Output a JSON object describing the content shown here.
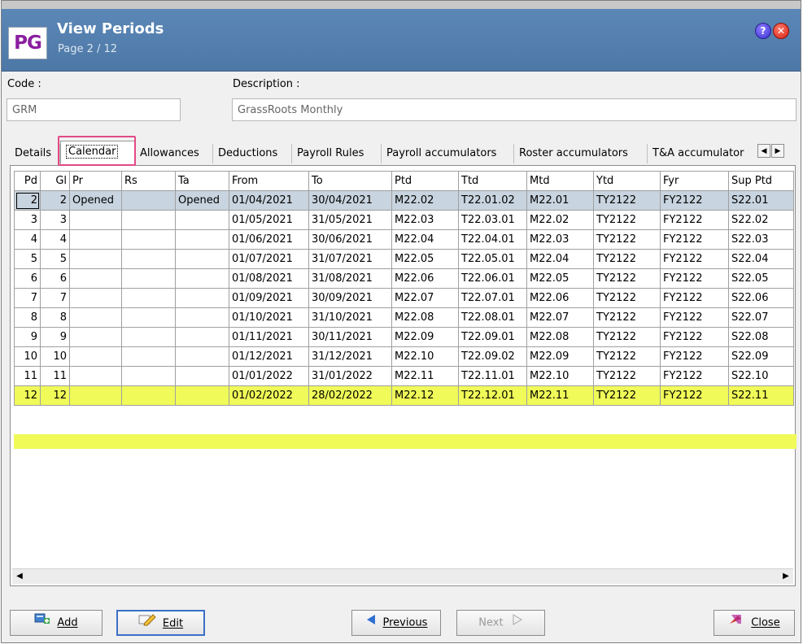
{
  "window": {
    "title": "View Periods",
    "subtitle": "Page 2 / 12",
    "logo": "PG",
    "help_glyph": "?",
    "close_glyph": "✕"
  },
  "form": {
    "code_label": "Code :",
    "code_value": "GRM",
    "description_label": "Description :",
    "description_value": "GrassRoots Monthly"
  },
  "tabs": [
    "Details",
    "Calendar",
    "Allowances",
    "Deductions",
    "Payroll Rules",
    "Payroll accumulators",
    "Roster accumulators",
    "T&A accumulator"
  ],
  "active_tab": "Calendar",
  "table": {
    "columns": [
      "Pd",
      "Gl",
      "Pr",
      "Rs",
      "Ta",
      "From",
      "To",
      "Ptd",
      "Ttd",
      "Mtd",
      "Ytd",
      "Fyr",
      "Sup Ptd"
    ],
    "rows": [
      [
        "2",
        "2",
        "Opened",
        "",
        "Opened",
        "01/04/2021",
        "30/04/2021",
        "M22.02",
        "T22.01.02",
        "M22.01",
        "TY2122",
        "FY2122",
        "S22.01"
      ],
      [
        "3",
        "3",
        "",
        "",
        "",
        "01/05/2021",
        "31/05/2021",
        "M22.03",
        "T22.03.01",
        "M22.02",
        "TY2122",
        "FY2122",
        "S22.02"
      ],
      [
        "4",
        "4",
        "",
        "",
        "",
        "01/06/2021",
        "30/06/2021",
        "M22.04",
        "T22.04.01",
        "M22.03",
        "TY2122",
        "FY2122",
        "S22.03"
      ],
      [
        "5",
        "5",
        "",
        "",
        "",
        "01/07/2021",
        "31/07/2021",
        "M22.05",
        "T22.05.01",
        "M22.04",
        "TY2122",
        "FY2122",
        "S22.04"
      ],
      [
        "6",
        "6",
        "",
        "",
        "",
        "01/08/2021",
        "31/08/2021",
        "M22.06",
        "T22.06.01",
        "M22.05",
        "TY2122",
        "FY2122",
        "S22.05"
      ],
      [
        "7",
        "7",
        "",
        "",
        "",
        "01/09/2021",
        "30/09/2021",
        "M22.07",
        "T22.07.01",
        "M22.06",
        "TY2122",
        "FY2122",
        "S22.06"
      ],
      [
        "8",
        "8",
        "",
        "",
        "",
        "01/10/2021",
        "31/10/2021",
        "M22.08",
        "T22.08.01",
        "M22.07",
        "TY2122",
        "FY2122",
        "S22.07"
      ],
      [
        "9",
        "9",
        "",
        "",
        "",
        "01/11/2021",
        "30/11/2021",
        "M22.09",
        "T22.09.01",
        "M22.08",
        "TY2122",
        "FY2122",
        "S22.08"
      ],
      [
        "10",
        "10",
        "",
        "",
        "",
        "01/12/2021",
        "31/12/2021",
        "M22.10",
        "T22.09.02",
        "M22.09",
        "TY2122",
        "FY2122",
        "S22.09"
      ],
      [
        "11",
        "11",
        "",
        "",
        "",
        "01/01/2022",
        "31/01/2022",
        "M22.11",
        "T22.11.01",
        "M22.10",
        "TY2122",
        "FY2122",
        "S22.10"
      ],
      [
        "12",
        "12",
        "",
        "",
        "",
        "01/02/2022",
        "28/02/2022",
        "M22.12",
        "T22.12.01",
        "M22.11",
        "TY2122",
        "FY2122",
        "S22.11"
      ]
    ],
    "selected_row": 0,
    "highlighted_row": 10
  },
  "buttons": {
    "add": "Add",
    "edit": "Edit",
    "previous": "Previous",
    "next": "Next",
    "close": "Close"
  },
  "colors": {
    "titlebar": "#4f7aa9",
    "logo_text": "#8a1fa0",
    "highlight": "#f0fa58",
    "selected_row": "#c8d4df",
    "tab_highlight_border": "#e24a86",
    "primary_border": "#3b6fc7"
  }
}
